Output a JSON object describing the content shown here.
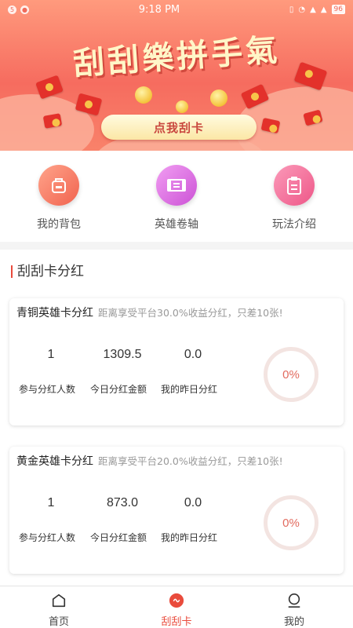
{
  "status_bar": {
    "time": "9:18 PM",
    "left_icons": [
      "notification-icon",
      "user-icon"
    ],
    "right_icons": [
      "vibrate-icon",
      "wifi-icon",
      "signal-icon",
      "signal-icon",
      "battery-icon"
    ],
    "battery": "96"
  },
  "banner": {
    "title": "刮刮樂拼手氣",
    "button_label": "点我刮卡"
  },
  "quick_menu": {
    "items": [
      {
        "label": "我的背包",
        "icon": "backpack-icon",
        "color": "#f7866f"
      },
      {
        "label": "英雄卷轴",
        "icon": "scroll-icon",
        "color": "#e985e8"
      },
      {
        "label": "玩法介绍",
        "icon": "clipboard-icon",
        "color": "#f47ea6"
      }
    ]
  },
  "section": {
    "title": "刮刮卡分红"
  },
  "cards": [
    {
      "name": "青铜英雄卡分红",
      "note": "距离享受平台30.0%收益分红，只差10张!",
      "participants": "1",
      "today_amount": "1309.5",
      "my_yesterday": "0.0",
      "participants_label": "参与分红人数",
      "today_amount_label": "今日分红金额",
      "my_yesterday_label": "我的昨日分红",
      "progress_text": "0%",
      "progress": 0
    },
    {
      "name": "黄金英雄卡分红",
      "note": "距离享受平台20.0%收益分红，只差10张!",
      "participants": "1",
      "today_amount": "873.0",
      "my_yesterday": "0.0",
      "participants_label": "参与分红人数",
      "today_amount_label": "今日分红金额",
      "my_yesterday_label": "我的昨日分红",
      "progress_text": "0%",
      "progress": 0
    }
  ],
  "tabbar": {
    "tabs": [
      {
        "label": "首页",
        "icon": "home-icon"
      },
      {
        "label": "刮刮卡",
        "icon": "scratch-card-icon",
        "active": true
      },
      {
        "label": "我的",
        "icon": "profile-icon"
      }
    ]
  },
  "colors": {
    "accent": "#e94b3c",
    "banner": "#f66c5f"
  }
}
